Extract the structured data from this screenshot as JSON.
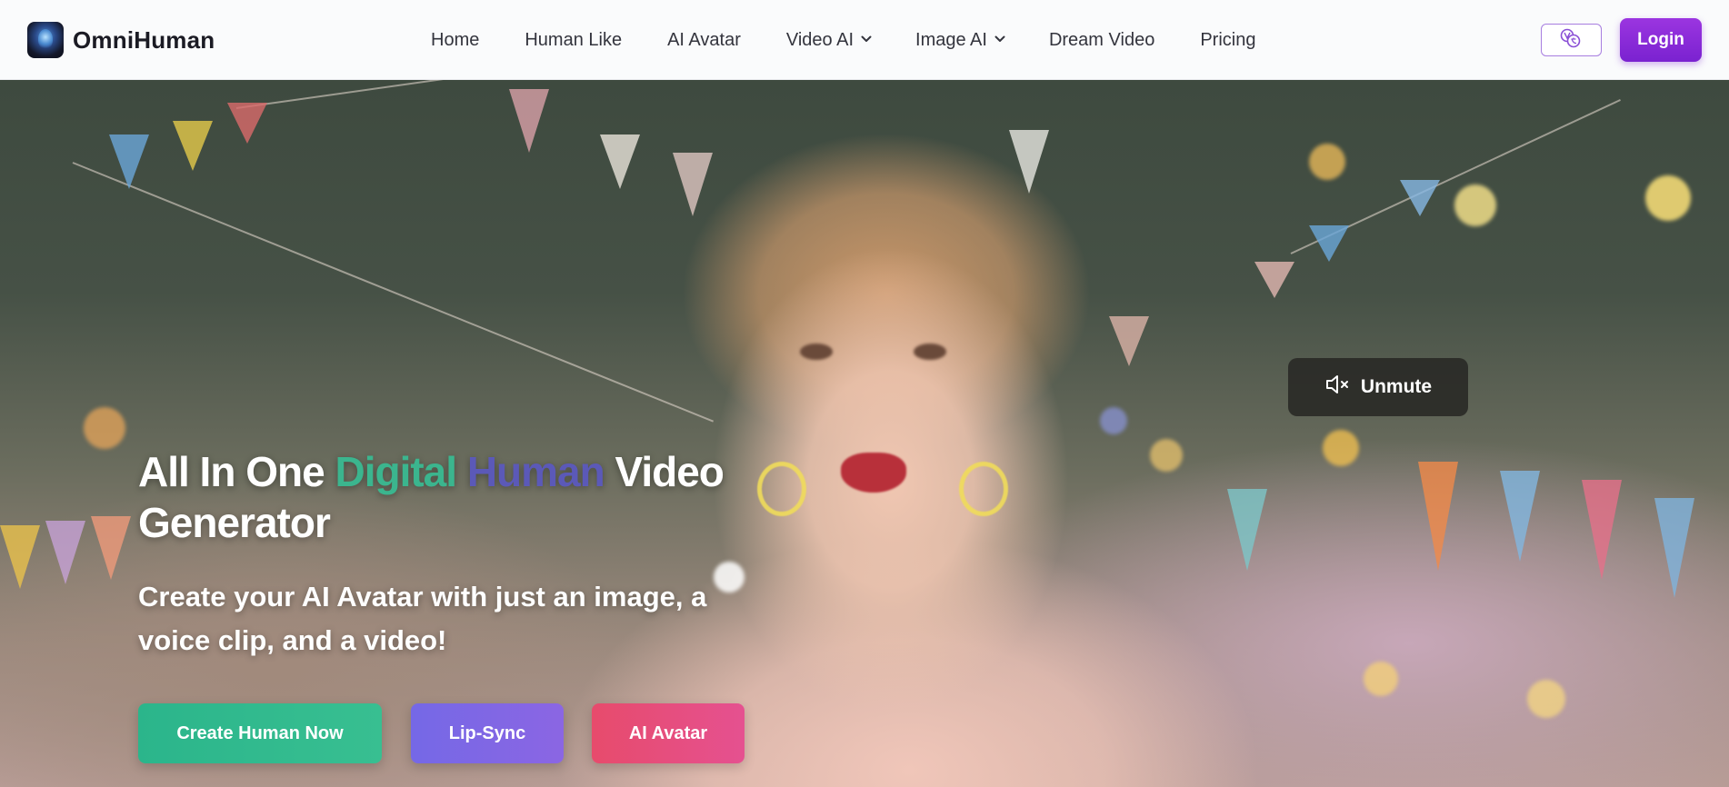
{
  "brand": {
    "name": "OmniHuman"
  },
  "nav": {
    "items": [
      {
        "label": "Home",
        "dropdown": false
      },
      {
        "label": "Human Like",
        "dropdown": false
      },
      {
        "label": "AI Avatar",
        "dropdown": false
      },
      {
        "label": "Video AI",
        "dropdown": true
      },
      {
        "label": "Image AI",
        "dropdown": true
      },
      {
        "label": "Dream Video",
        "dropdown": false
      },
      {
        "label": "Pricing",
        "dropdown": false
      }
    ]
  },
  "header": {
    "language_icon": "translate-icon",
    "login_label": "Login"
  },
  "hero": {
    "unmute_label": "Unmute",
    "unmute_icon": "speaker-muted-icon",
    "title": {
      "part1": "All In One ",
      "part2": "Digital",
      "part3": " ",
      "part4": "Human",
      "part5": " Video Generator"
    },
    "subtitle": "Create your AI Avatar with just an image, a voice clip, and a video!",
    "buttons": {
      "create": "Create Human Now",
      "lipsync": "Lip-Sync",
      "avatar": "AI Avatar"
    }
  },
  "colors": {
    "accent_purple": "#8a2be2",
    "title_green": "#3bb58e",
    "title_purple": "#5b59b8",
    "cta_green": "#2bb58b",
    "cta_purple": "#7568e6",
    "cta_pink": "#e74b6c"
  }
}
